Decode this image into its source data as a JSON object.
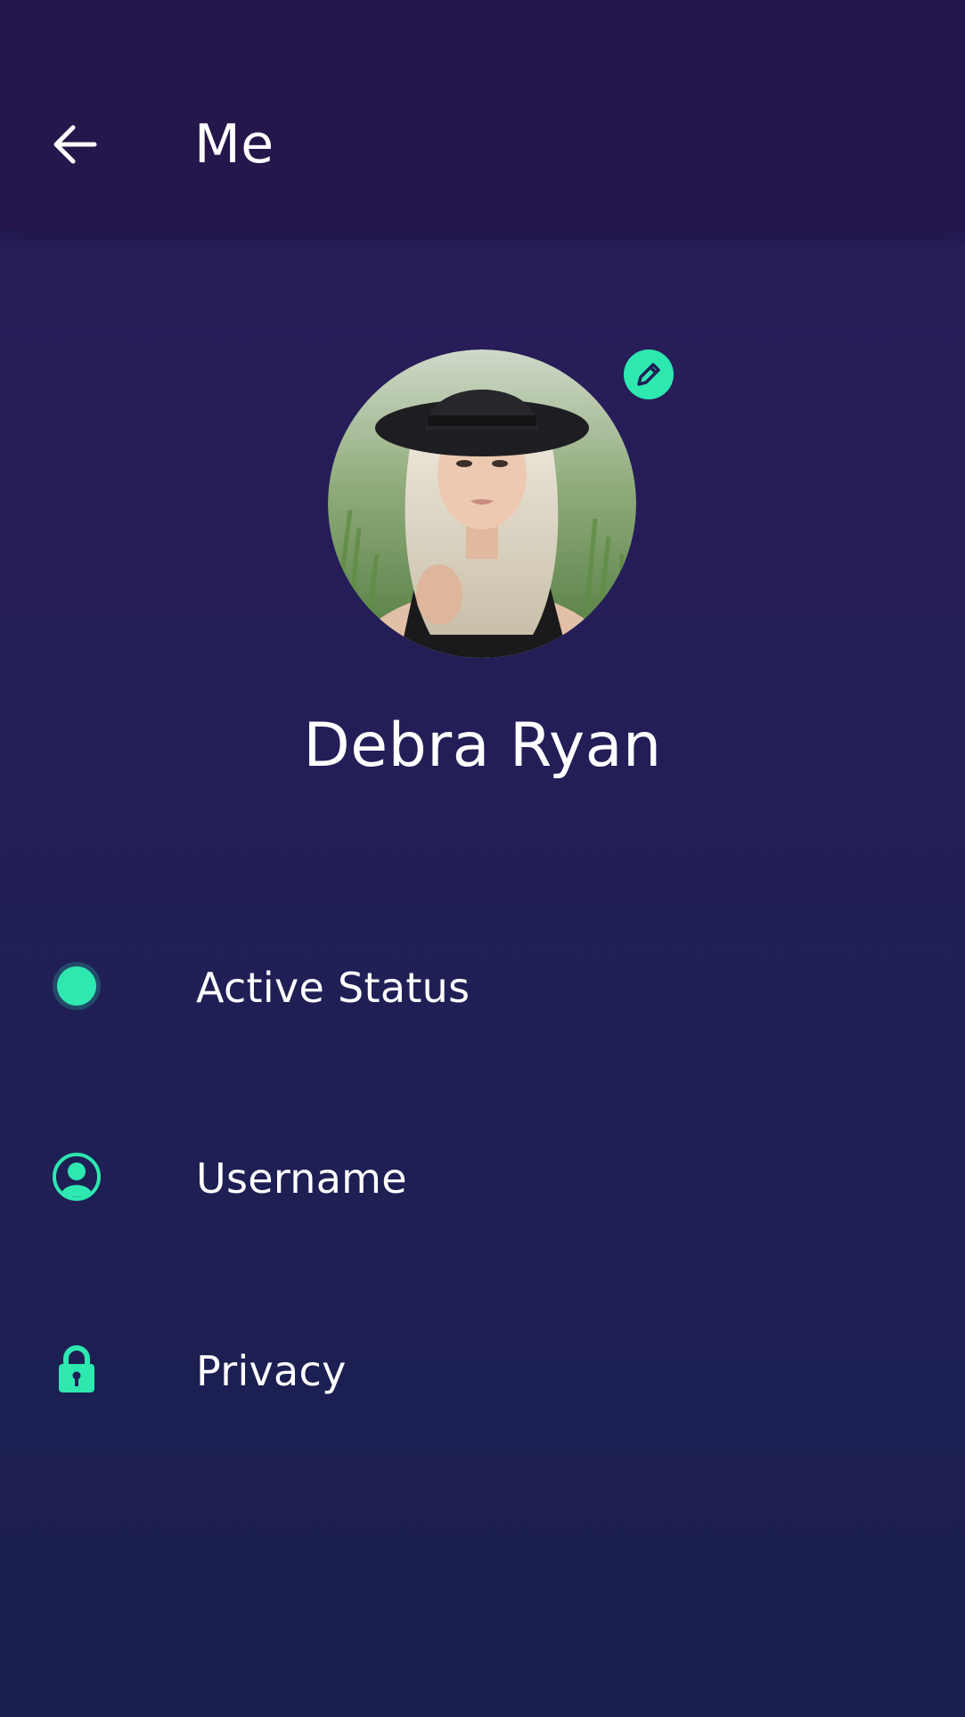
{
  "header": {
    "title": "Me",
    "back_icon": "arrow-left-icon"
  },
  "profile": {
    "name": "Debra Ryan",
    "edit_icon": "pencil-icon"
  },
  "menu": [
    {
      "label": "Active Status",
      "icon": "status-dot-icon"
    },
    {
      "label": "Username",
      "icon": "user-circle-icon"
    },
    {
      "label": "Privacy",
      "icon": "lock-icon"
    }
  ],
  "colors": {
    "accent": "#2ee8b0",
    "app_bar": "#25164b",
    "background_top": "#2a1c5a",
    "background_bottom": "#1a1f4e",
    "text": "#ffffff"
  }
}
